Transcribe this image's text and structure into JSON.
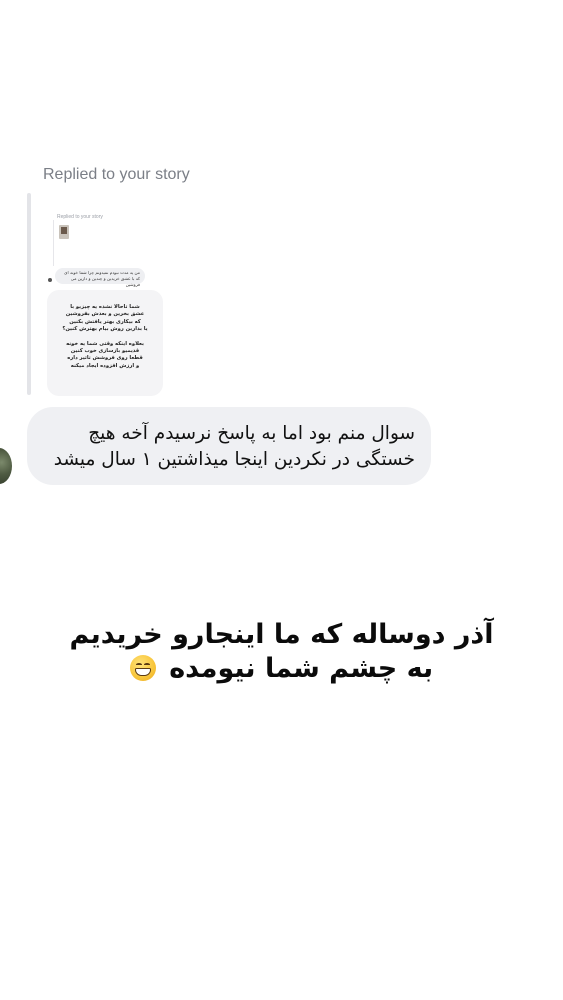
{
  "story_reply": {
    "label": "Replied to your story",
    "thumbnail": {
      "label": "Replied to your story",
      "bubble_text": "من یه مدت نبودم نمیدونم چرا شما خونه ای که با عشق خریدین و چندین و دارین می فروشین",
      "card_lines": [
        "شما تاحالا نشده یه چیزیو با",
        "عشق بخرین و بعدش بفروشین",
        "که بیکاری بهتر یافتش بکنین",
        "یا بدارین روش بیام بهترش کنین؟"
      ],
      "card_lines_2": [
        "بعلاوه اینکه وقتی شما یه خونه",
        "قدیمیو بازسازی خوب کنین",
        "قطعا روی فروشش تاثیر داره",
        "و ارزش افزوده ایجاد میکنه"
      ]
    }
  },
  "reply_message": {
    "lines": [
      "سوال منم بود اما به پاسخ نرسیدم آخه هیچ",
      "خستگی در نکردین اینجا میذاشتین ۱ سال میشد"
    ]
  },
  "caption": {
    "line1": "آذر دوساله که ما اینجارو خریدیم",
    "line2": "به چشم شما نیومده",
    "emoji": "grinning-face-icon"
  }
}
